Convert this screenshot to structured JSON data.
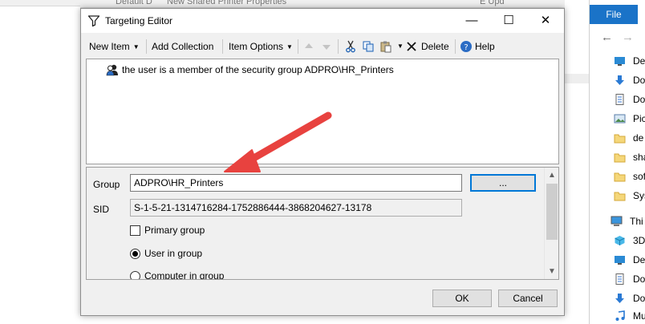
{
  "background": {
    "behind_text_left": "Default D",
    "behind_text_center": "New Shared Printer Properties",
    "behind_text_right": "E  Upd"
  },
  "dialog": {
    "title": "Targeting Editor",
    "window_controls": {
      "minimize": "—",
      "maximize": "☐",
      "close": "✕"
    },
    "toolbar": {
      "new_item": "New Item",
      "add_collection": "Add Collection",
      "item_options": "Item Options",
      "delete": "Delete",
      "help": "Help"
    },
    "rule_item": "the user is a member of the security group ADPRO\\HR_Printers",
    "properties": {
      "group_label": "Group",
      "group_value": "ADPRO\\HR_Printers",
      "browse_button": "...",
      "sid_label": "SID",
      "sid_value": "S-1-5-21-1314716284-1752886444-3868204627-13178",
      "primary_group": {
        "label": "Primary group",
        "checked": false
      },
      "user_in_group": {
        "label": "User in group",
        "selected": true
      },
      "computer_in_group": {
        "label": "Computer in group",
        "selected": false
      }
    },
    "ok": "OK",
    "cancel": "Cancel"
  },
  "explorer": {
    "file_tab": "File",
    "items": [
      {
        "label": "De",
        "icon": "desktop-icon"
      },
      {
        "label": "Do",
        "icon": "download-icon"
      },
      {
        "label": "Do",
        "icon": "document-icon"
      },
      {
        "label": "Pic",
        "icon": "pictures-icon"
      },
      {
        "label": "de",
        "icon": "folder-icon"
      },
      {
        "label": "sha",
        "icon": "folder-icon"
      },
      {
        "label": "sof",
        "icon": "folder-icon"
      },
      {
        "label": "Sys",
        "icon": "folder-icon"
      },
      {
        "label": "This",
        "icon": "computer-icon"
      },
      {
        "label": "3D",
        "icon": "3d-objects-icon"
      },
      {
        "label": "De",
        "icon": "desktop-icon"
      },
      {
        "label": "Do",
        "icon": "document-icon"
      },
      {
        "label": "Do",
        "icon": "download-icon"
      },
      {
        "label": "Mu",
        "icon": "music-icon"
      }
    ]
  },
  "colors": {
    "accent": "#0078d7",
    "file_tab": "#1a73c8",
    "annotation_arrow": "#e8423f"
  }
}
